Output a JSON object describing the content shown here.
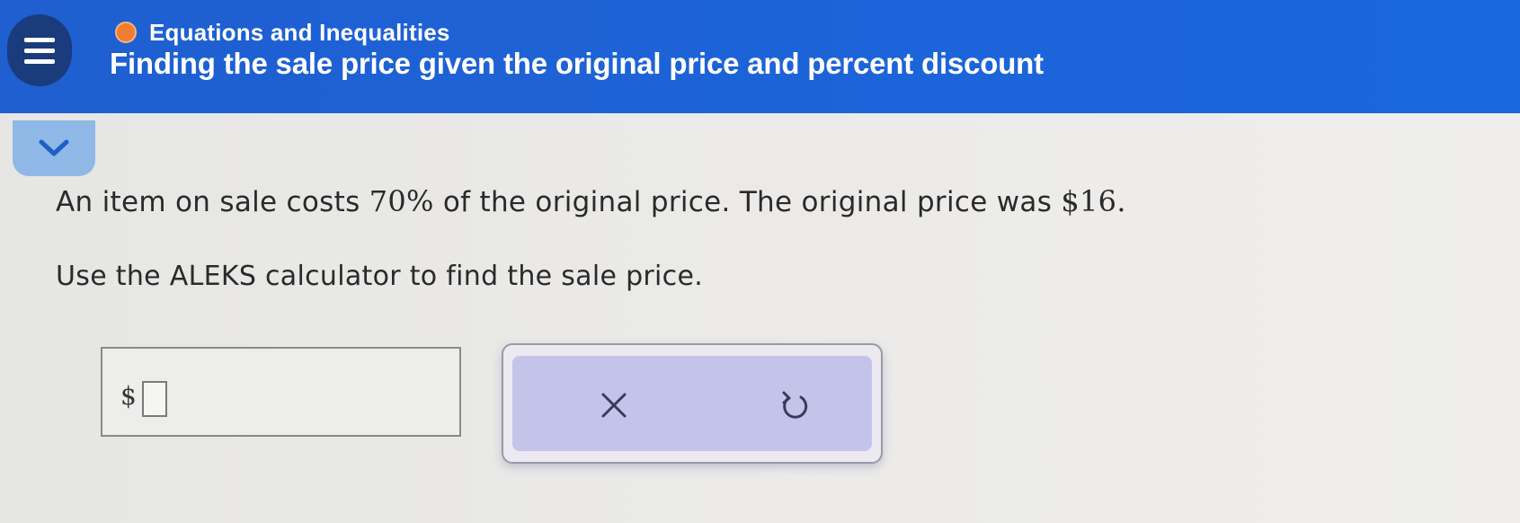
{
  "header": {
    "topic": "Equations and Inequalities",
    "title": "Finding the sale price given the original price and percent discount",
    "accent_color": "#1d63d8",
    "topic_dot_color": "#f07d33",
    "menu_icon": "hamburger-menu-icon"
  },
  "collapse": {
    "icon": "chevron-down-icon"
  },
  "question": {
    "part1": "An item on sale costs ",
    "percent": "70%",
    "part2": " of the original price. The original price was ",
    "price": "$16",
    "part3": ".",
    "instruction": "Use the ALEKS calculator to find the sale price."
  },
  "answer": {
    "currency_symbol": "$",
    "value": ""
  },
  "controls": {
    "clear_icon": "close-icon",
    "undo_icon": "undo-icon",
    "panel_color": "#c4c4ea"
  }
}
